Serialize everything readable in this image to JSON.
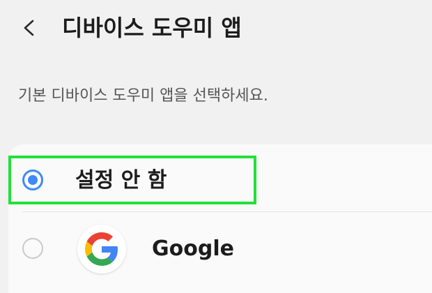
{
  "header": {
    "title": "디바이스 도우미 앱",
    "back_icon": "back-arrow-icon"
  },
  "description": "기본 디바이스 도우미 앱을 선택하세요.",
  "options": [
    {
      "label": "설정 안 함",
      "selected": true
    },
    {
      "label": "Google",
      "selected": false,
      "icon": "google-g-icon"
    }
  ],
  "colors": {
    "background": "#f1f1f1",
    "card": "#fafafa",
    "radio_selected": "#3e8af7",
    "highlight": "#22e03a"
  }
}
